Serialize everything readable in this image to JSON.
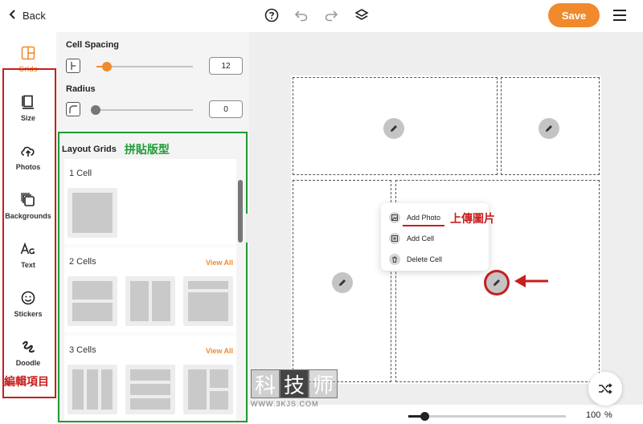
{
  "header": {
    "back_label": "Back",
    "save_label": "Save",
    "icons": [
      "chevron-left-icon",
      "help-icon",
      "undo-icon",
      "redo-icon",
      "layers-icon",
      "menu-icon"
    ],
    "accent_color": "#f08a2c"
  },
  "sidebar": {
    "items": [
      {
        "label": "Grids",
        "icon": "grid-icon",
        "active": true
      },
      {
        "label": "Size",
        "icon": "size-icon",
        "active": false
      },
      {
        "label": "Photos",
        "icon": "upload-cloud-icon",
        "active": false
      },
      {
        "label": "Backgrounds",
        "icon": "backgrounds-icon",
        "active": false
      },
      {
        "label": "Text",
        "icon": "text-icon",
        "active": false
      },
      {
        "label": "Stickers",
        "icon": "smiley-icon",
        "active": false
      },
      {
        "label": "Doodle",
        "icon": "doodle-icon",
        "active": false
      }
    ],
    "caption": "編輯項目",
    "caption_color": "#c81e1e"
  },
  "panel": {
    "cell_spacing": {
      "label": "Cell Spacing",
      "value": "12",
      "level": 0.12
    },
    "radius": {
      "label": "Radius",
      "value": "0",
      "level": 0
    },
    "layout": {
      "title": "Layout Grids",
      "caption": "拼貼版型",
      "caption_color": "#1f9a35",
      "sections": [
        {
          "label": "1 Cell",
          "view_all": ""
        },
        {
          "label": "2 Cells",
          "view_all": "View All"
        },
        {
          "label": "3 Cells",
          "view_all": "View All"
        }
      ]
    }
  },
  "canvas": {
    "context_menu": {
      "items": [
        {
          "label": "Add Photo",
          "icon": "photo-icon"
        },
        {
          "label": "Add Cell",
          "icon": "add-cell-icon"
        },
        {
          "label": "Delete Cell",
          "icon": "trash-icon"
        }
      ]
    },
    "upload_caption": "上傳圖片",
    "watermark": {
      "chars": [
        "科",
        "技",
        "师"
      ],
      "url": "WWW.3KJS.COM"
    }
  },
  "zoom": {
    "value": "100",
    "unit": "%",
    "level": 0.1
  }
}
